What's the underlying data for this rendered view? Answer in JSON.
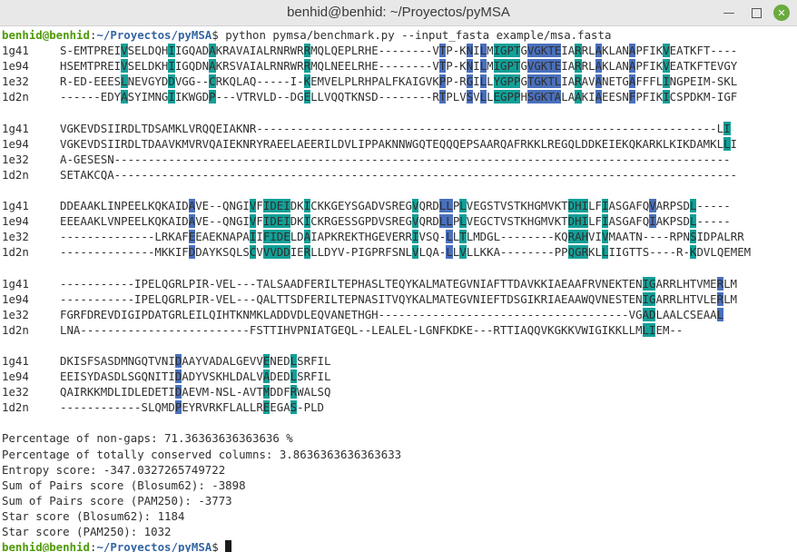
{
  "window": {
    "title": "benhid@benhid: ~/Proyectos/pyMSA"
  },
  "icons": {
    "minimize": "minimize-icon",
    "maximize": "maximize-icon",
    "close": "close-icon"
  },
  "colors": {
    "teal": "#12a097",
    "blue": "#4a70bd",
    "prompt_user": "#4e9a06",
    "prompt_path": "#3465a4"
  },
  "prompt": {
    "user": "benhid@benhid",
    "sep": ":",
    "path": "~/Proyectos/pyMSA",
    "symbol": "$"
  },
  "command": " python pymsa/benchmark.py --input_fasta example/msa.fasta",
  "blocks": [
    [
      {
        "id": "1g41",
        "seq": "S-EMTPREIVSELDQHIIGQADAKRAVAIALRNRWRRMQLQEPLRHE--------VTP-KNILMIGPTGVGKTEIARRLAKLANAPFIKVEATKFT----",
        "hl": [
          [
            9,
            "t"
          ],
          [
            16,
            "t"
          ],
          [
            22,
            "t"
          ],
          [
            36,
            "t"
          ],
          [
            56,
            "b"
          ],
          [
            60,
            "b"
          ],
          [
            62,
            "b"
          ],
          [
            64,
            "t"
          ],
          [
            65,
            "t"
          ],
          [
            66,
            "t"
          ],
          [
            67,
            "t"
          ],
          [
            69,
            "b"
          ],
          [
            70,
            "b"
          ],
          [
            71,
            "b"
          ],
          [
            72,
            "b"
          ],
          [
            73,
            "b"
          ],
          [
            76,
            "t"
          ],
          [
            79,
            "b"
          ],
          [
            84,
            "b"
          ],
          [
            89,
            "t"
          ]
        ]
      },
      {
        "id": "1e94",
        "seq": "HSEMTPREIVSELDKHIIGQDNAKRSVAIALRNRWRRMQLNEELRHE--------VTP-KNILMIGPTGVGKTEIARRLAKLANAPFIKVEATKFTEVGY",
        "hl": [
          [
            9,
            "t"
          ],
          [
            16,
            "t"
          ],
          [
            22,
            "t"
          ],
          [
            36,
            "t"
          ],
          [
            56,
            "b"
          ],
          [
            60,
            "b"
          ],
          [
            62,
            "b"
          ],
          [
            64,
            "t"
          ],
          [
            65,
            "t"
          ],
          [
            66,
            "t"
          ],
          [
            67,
            "t"
          ],
          [
            69,
            "b"
          ],
          [
            70,
            "b"
          ],
          [
            71,
            "b"
          ],
          [
            72,
            "b"
          ],
          [
            73,
            "b"
          ],
          [
            76,
            "t"
          ],
          [
            79,
            "b"
          ],
          [
            84,
            "b"
          ],
          [
            89,
            "t"
          ]
        ]
      },
      {
        "id": "1e32",
        "seq": "R-ED-EEESLNEVGYDDVGG--CRKQLAQ-----I-KEMVELPLRHPALFKAIGVKPP-RGILLYGPPGTGKTLIARAVANETGAFFFLINGPEIM-SKL",
        "hl": [
          [
            9,
            "t"
          ],
          [
            16,
            "t"
          ],
          [
            22,
            "t"
          ],
          [
            36,
            "t"
          ],
          [
            56,
            "b"
          ],
          [
            60,
            "b"
          ],
          [
            62,
            "b"
          ],
          [
            64,
            "t"
          ],
          [
            65,
            "t"
          ],
          [
            66,
            "t"
          ],
          [
            67,
            "t"
          ],
          [
            69,
            "b"
          ],
          [
            70,
            "b"
          ],
          [
            71,
            "b"
          ],
          [
            72,
            "b"
          ],
          [
            73,
            "b"
          ],
          [
            76,
            "t"
          ],
          [
            79,
            "b"
          ],
          [
            84,
            "b"
          ],
          [
            89,
            "t"
          ]
        ]
      },
      {
        "id": "1d2n",
        "seq": "------EDYASYIMNGIIKWGDP---VTRVLD--DGELLVQQTKNSD--------RTPLVSVLLEGPPHSGKTALAAKIAEESNFPFIKICSPDKM-IGF",
        "hl": [
          [
            9,
            "t"
          ],
          [
            16,
            "t"
          ],
          [
            22,
            "t"
          ],
          [
            36,
            "t"
          ],
          [
            56,
            "b"
          ],
          [
            60,
            "b"
          ],
          [
            62,
            "b"
          ],
          [
            64,
            "t"
          ],
          [
            65,
            "t"
          ],
          [
            66,
            "t"
          ],
          [
            67,
            "t"
          ],
          [
            69,
            "b"
          ],
          [
            70,
            "b"
          ],
          [
            71,
            "b"
          ],
          [
            72,
            "b"
          ],
          [
            73,
            "b"
          ],
          [
            76,
            "t"
          ],
          [
            79,
            "b"
          ],
          [
            84,
            "b"
          ],
          [
            89,
            "t"
          ]
        ]
      }
    ],
    [
      {
        "id": "1g41",
        "seq": "VGKEVDSIIRDLTDSAMKLVRQQEIAKNR--------------------------------------------------------------------LI",
        "hl": [
          [
            98,
            "t"
          ]
        ]
      },
      {
        "id": "1e94",
        "seq": "VGKEVDSIIRDLTDAAVKMVRVQAIEKNRYRAEELAEERILDVLIPPAKNNWGQTEQQQEPSAARQAFRKKLREGQLDDKEIEKQKARKLKIKDAMKLLI",
        "hl": [
          [
            98,
            "t"
          ]
        ]
      },
      {
        "id": "1e32",
        "seq": "A-GESESN-------------------------------------------------------------------------------------------",
        "hl": [
          [
            98,
            "t"
          ]
        ]
      },
      {
        "id": "1d2n",
        "seq": "SETAKCQA--------------------------------------------------------------------------------------------",
        "hl": [
          [
            98,
            "t"
          ]
        ]
      }
    ],
    [
      {
        "id": "1g41",
        "seq": "DDEAAKLINPEELKQKAIDAVE--QNGIVFIDEIDKICKKGEYSGADVSREGVQRDLLPLVEGSTVSTKHGMVKTDHILFIASGAFQVARPSDL-----",
        "hl": [
          [
            19,
            "b"
          ],
          [
            28,
            "t"
          ],
          [
            30,
            "t"
          ],
          [
            31,
            "t"
          ],
          [
            32,
            "t"
          ],
          [
            33,
            "t"
          ],
          [
            36,
            "t"
          ],
          [
            52,
            "t"
          ],
          [
            56,
            "b"
          ],
          [
            57,
            "b"
          ],
          [
            59,
            "t"
          ],
          [
            75,
            "t"
          ],
          [
            76,
            "t"
          ],
          [
            77,
            "t"
          ],
          [
            80,
            "t"
          ],
          [
            87,
            "b"
          ],
          [
            93,
            "t"
          ]
        ]
      },
      {
        "id": "1e94",
        "seq": "EEEAAKLVNPEELKQKAIDAVE--QNGIVFIDEIDKICKRGESSGPDVSREGVQRDLLPLVEGCTVSTKHGMVKTDHILFIASGAFQIAKPSDL-----",
        "hl": [
          [
            19,
            "b"
          ],
          [
            28,
            "t"
          ],
          [
            30,
            "t"
          ],
          [
            31,
            "t"
          ],
          [
            32,
            "t"
          ],
          [
            33,
            "t"
          ],
          [
            36,
            "t"
          ],
          [
            52,
            "t"
          ],
          [
            56,
            "b"
          ],
          [
            57,
            "b"
          ],
          [
            59,
            "t"
          ],
          [
            75,
            "t"
          ],
          [
            76,
            "t"
          ],
          [
            77,
            "t"
          ],
          [
            80,
            "t"
          ],
          [
            87,
            "b"
          ],
          [
            93,
            "t"
          ]
        ]
      },
      {
        "id": "1e32",
        "seq": "--------------LRKAFEEAEKNAPAIIFIDELDAIAPKREKTHGEVERRIVSQ-LLTLMDGL--------KQRAHVIVMAATN----RPNSIDPALRR",
        "hl": [
          [
            19,
            "b"
          ],
          [
            28,
            "t"
          ],
          [
            30,
            "t"
          ],
          [
            31,
            "t"
          ],
          [
            32,
            "t"
          ],
          [
            33,
            "t"
          ],
          [
            36,
            "t"
          ],
          [
            52,
            "t"
          ],
          [
            56,
            "b"
          ],
          [
            57,
            "b"
          ],
          [
            59,
            "t"
          ],
          [
            75,
            "t"
          ],
          [
            76,
            "t"
          ],
          [
            77,
            "t"
          ],
          [
            80,
            "t"
          ],
          [
            87,
            "b"
          ],
          [
            93,
            "t"
          ]
        ]
      },
      {
        "id": "1d2n",
        "seq": "--------------MKKIFDDAYKSQLSCVVVDDIERLLDYV-PIGPRFSNLVLQA-LLVLLKKA--------PPQGRKLLIIGTTS----R-KDVLQEMEM",
        "hl": [
          [
            19,
            "b"
          ],
          [
            28,
            "t"
          ],
          [
            30,
            "t"
          ],
          [
            31,
            "t"
          ],
          [
            32,
            "t"
          ],
          [
            33,
            "t"
          ],
          [
            36,
            "t"
          ],
          [
            52,
            "t"
          ],
          [
            56,
            "b"
          ],
          [
            57,
            "b"
          ],
          [
            59,
            "t"
          ],
          [
            75,
            "t"
          ],
          [
            76,
            "t"
          ],
          [
            77,
            "t"
          ],
          [
            80,
            "t"
          ],
          [
            87,
            "b"
          ],
          [
            93,
            "t"
          ]
        ]
      }
    ],
    [
      {
        "id": "1g41",
        "seq": "-----------IPELQGRLPIR-VEL---TALSAADFERILTEPHASLTEQYKALMATEGVNIAFTTDAVKKIAEAAFRVNEKTENIGARRLHTVMERLM",
        "hl": [
          [
            86,
            "t"
          ],
          [
            87,
            "t"
          ],
          [
            97,
            "b"
          ]
        ]
      },
      {
        "id": "1e94",
        "seq": "-----------IPELQGRLPIR-VEL---QALTTSDFERILTEPNASITVQYKALMATEGVNIEFTDSGIKRIAEAAWQVNESTENIGARRLHTVLERLM",
        "hl": [
          [
            86,
            "t"
          ],
          [
            87,
            "t"
          ],
          [
            97,
            "b"
          ]
        ]
      },
      {
        "id": "1e32",
        "seq": "FGRFDREVDIGIPDATGRLEILQIHTKNMKLADDVDLEQVANETHGH-------------------------------------VGADLAALCSEAAL",
        "hl": [
          [
            86,
            "t"
          ],
          [
            87,
            "t"
          ],
          [
            97,
            "b"
          ]
        ]
      },
      {
        "id": "1d2n",
        "seq": "LNA-------------------------FSTTIHVPNIATGEQL--LEALEL-LGNFKDKE---RTTIAQQVKGKKVWIGIKKLLMLIEM--",
        "hl": [
          [
            86,
            "t"
          ],
          [
            87,
            "t"
          ],
          [
            97,
            "b"
          ]
        ]
      }
    ],
    [
      {
        "id": "1g41",
        "seq": "DKISFSASDMNGQTVNIDAAYVADALGEVVENEDLSRFIL",
        "hl": [
          [
            17,
            "b"
          ],
          [
            30,
            "t"
          ],
          [
            34,
            "t"
          ]
        ]
      },
      {
        "id": "1e94",
        "seq": "EEISYDASDLSGQNITIDADYVSKHLDALVADEDLSRFIL",
        "hl": [
          [
            17,
            "b"
          ],
          [
            30,
            "t"
          ],
          [
            34,
            "t"
          ]
        ]
      },
      {
        "id": "1e32",
        "seq": "QAIRKKMDLIDLEDETIDAEVM-NSL-AVTMDDFRWALSQ",
        "hl": [
          [
            17,
            "b"
          ],
          [
            30,
            "t"
          ],
          [
            34,
            "t"
          ]
        ]
      },
      {
        "id": "1d2n",
        "seq": "------------SLQMDPEYRVRKFLALLREEGAS-PLD",
        "hl": [
          [
            17,
            "b"
          ],
          [
            30,
            "t"
          ],
          [
            34,
            "t"
          ]
        ]
      }
    ]
  ],
  "results": [
    "Percentage of non-gaps: 71.36363636363636 %",
    "Percentage of totally conserved columns: 3.8636363636363633",
    "Entropy score: -347.0327265749722",
    "Sum of Pairs score (Blosum62): -3898",
    "Sum of Pairs score (PAM250): -3773",
    "Star score (Blosum62): 1184",
    "Star score (PAM250): 1032"
  ]
}
